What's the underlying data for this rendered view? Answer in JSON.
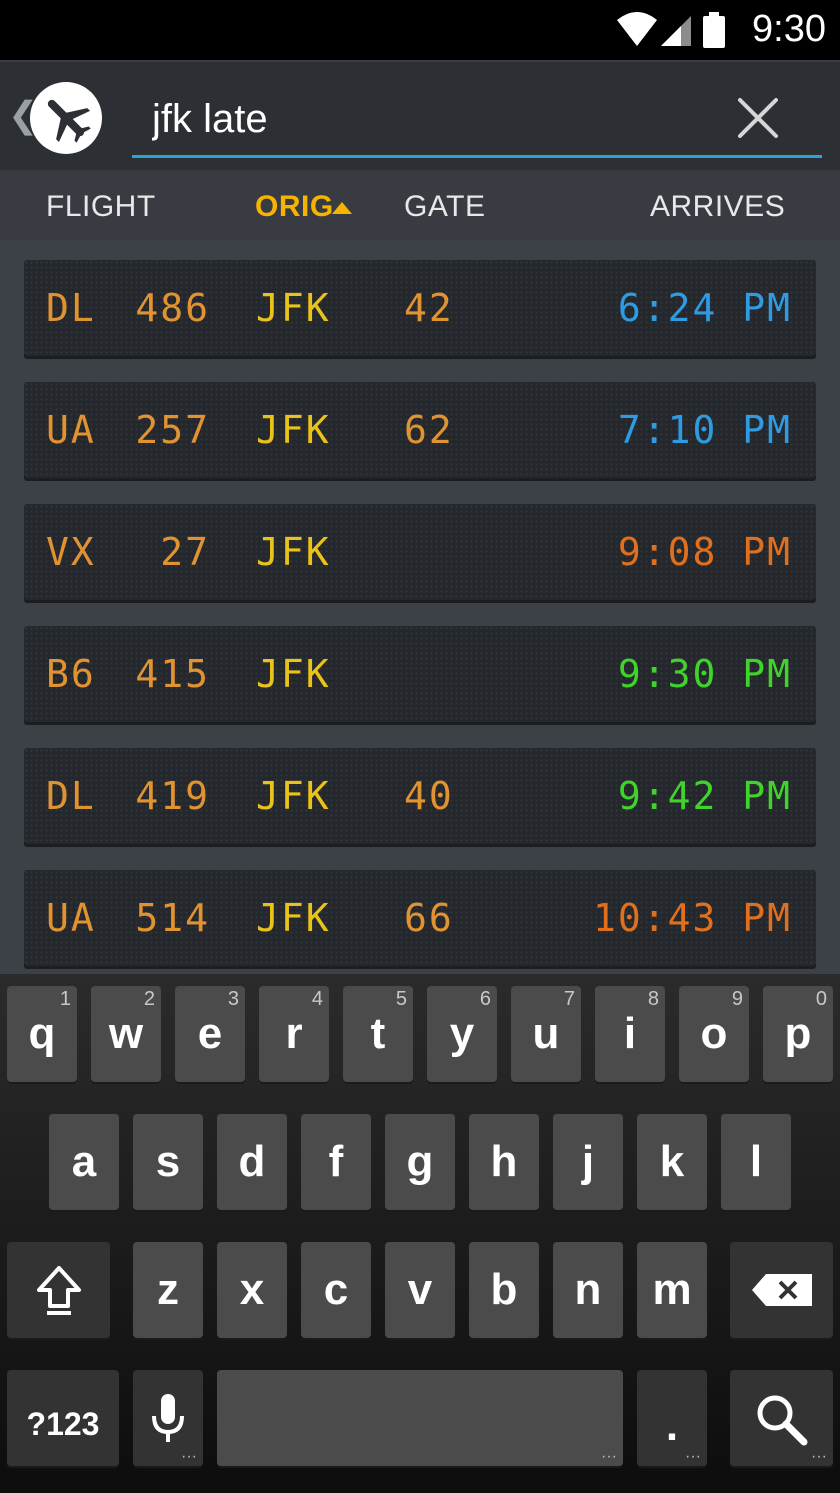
{
  "status_bar": {
    "time": "9:30",
    "icons": [
      "wifi-icon",
      "signal-icon",
      "battery-icon"
    ]
  },
  "search": {
    "value": "jfk late",
    "clear_icon": "close-icon"
  },
  "columns": [
    {
      "label": "FLIGHT",
      "active": false
    },
    {
      "label": "ORIG",
      "active": true,
      "sort": "ascending"
    },
    {
      "label": "GATE",
      "active": false
    },
    {
      "label": "ARRIVES",
      "active": false
    }
  ],
  "flights": [
    {
      "airline": "DL",
      "number": "486",
      "orig": "JFK",
      "gate": "42",
      "arrives": "6:24 PM",
      "arrives_color": "#2f9be3"
    },
    {
      "airline": "UA",
      "number": "257",
      "orig": "JFK",
      "gate": "62",
      "arrives": "7:10 PM",
      "arrives_color": "#2f9be3"
    },
    {
      "airline": "VX",
      "number": "27",
      "orig": "JFK",
      "gate": "",
      "arrives": "9:08 PM",
      "arrives_color": "#e0701e"
    },
    {
      "airline": "B6",
      "number": "415",
      "orig": "JFK",
      "gate": "",
      "arrives": "9:30 PM",
      "arrives_color": "#3fd32b"
    },
    {
      "airline": "DL",
      "number": "419",
      "orig": "JFK",
      "gate": "40",
      "arrives": "9:42 PM",
      "arrives_color": "#3fd32b"
    },
    {
      "airline": "UA",
      "number": "514",
      "orig": "JFK",
      "gate": "66",
      "arrives": "10:43 PM",
      "arrives_color": "#e0701e"
    }
  ],
  "keyboard": {
    "row1": [
      {
        "key": "q",
        "hint": "1"
      },
      {
        "key": "w",
        "hint": "2"
      },
      {
        "key": "e",
        "hint": "3"
      },
      {
        "key": "r",
        "hint": "4"
      },
      {
        "key": "t",
        "hint": "5"
      },
      {
        "key": "y",
        "hint": "6"
      },
      {
        "key": "u",
        "hint": "7"
      },
      {
        "key": "i",
        "hint": "8"
      },
      {
        "key": "o",
        "hint": "9"
      },
      {
        "key": "p",
        "hint": "0"
      }
    ],
    "row2": [
      "a",
      "s",
      "d",
      "f",
      "g",
      "h",
      "j",
      "k",
      "l"
    ],
    "row3": [
      "z",
      "x",
      "c",
      "v",
      "b",
      "n",
      "m"
    ],
    "symbols_label": "?123",
    "period": ".",
    "special_icons": [
      "shift-icon",
      "backspace-icon",
      "microphone-icon",
      "search-icon"
    ]
  },
  "colors": {
    "accent": "#2aa4d8",
    "sort_active": "#f6b400",
    "orig_text": "#e9c21a",
    "flight_text": "#e29331"
  }
}
